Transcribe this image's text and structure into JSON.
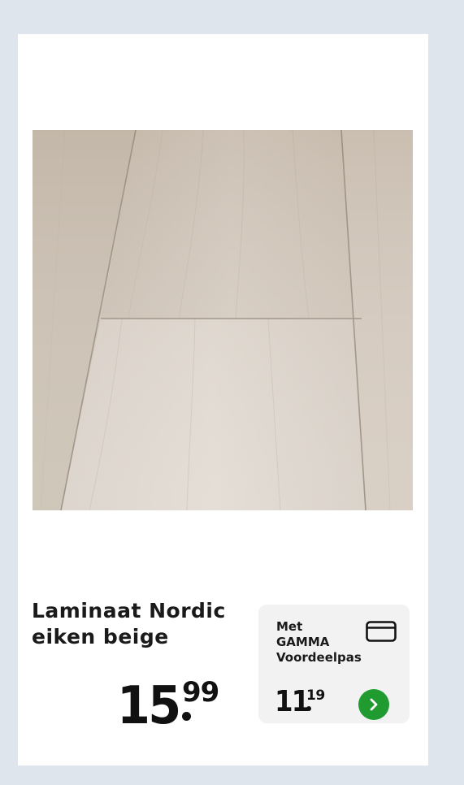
{
  "product": {
    "title_line1": "Laminaat Nordic",
    "title_line2": "eiken beige",
    "price": {
      "whole": "15",
      "cents": "99"
    }
  },
  "promo": {
    "line1": "Met",
    "line2": "GAMMA",
    "line3": "Voordeelpas",
    "price": {
      "whole": "11",
      "cents": "19"
    },
    "card_icon": "card-icon",
    "arrow_icon": "chevron-right-icon"
  },
  "colors": {
    "background": "#dfe5ec",
    "card": "#ffffff",
    "promo_box": "#f2f2f2",
    "accent_green": "#1f9b2f",
    "text": "#111111"
  }
}
